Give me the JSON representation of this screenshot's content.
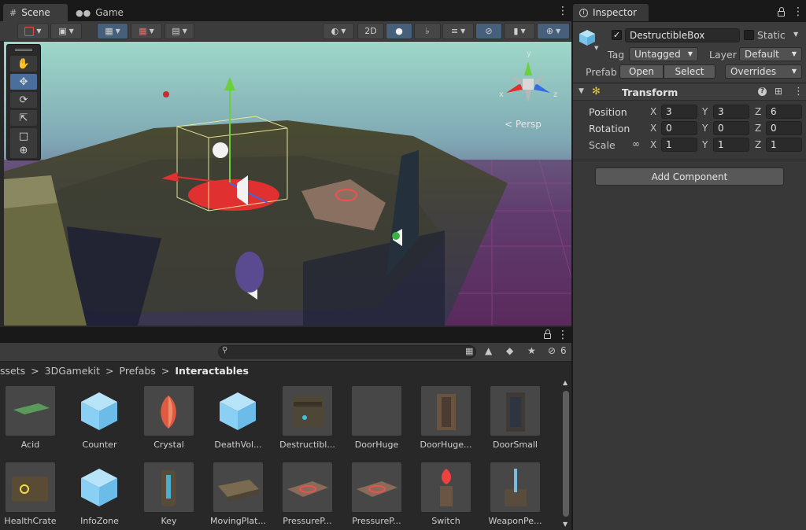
{
  "scene_tabs": [
    {
      "label": "Scene",
      "icon": "grid-icon"
    },
    {
      "label": "Game",
      "icon": "gamepad-icon"
    }
  ],
  "scene_toolbar": {
    "mode_2d": "2D"
  },
  "viewport": {
    "projection_label": "Persp",
    "gizmo_axes": {
      "x": "x",
      "y": "y",
      "z": "z"
    }
  },
  "project": {
    "filter_count": "6",
    "breadcrumb": [
      "ssets",
      "3DGamekit",
      "Prefabs",
      "Interactables"
    ],
    "assets": [
      {
        "label": "Acid",
        "thumb": "flat-green-plate"
      },
      {
        "label": "Counter",
        "thumb": "blue-cube"
      },
      {
        "label": "Crystal",
        "thumb": "red-crystal"
      },
      {
        "label": "DeathVol...",
        "thumb": "blue-cube"
      },
      {
        "label": "Destructibl...",
        "thumb": "crate"
      },
      {
        "label": "DoorHuge",
        "thumb": "empty"
      },
      {
        "label": "DoorHuge...",
        "thumb": "stone-door"
      },
      {
        "label": "DoorSmall",
        "thumb": "small-door"
      },
      {
        "label": "HealthCrate",
        "thumb": "health-crate"
      },
      {
        "label": "InfoZone",
        "thumb": "blue-cube"
      },
      {
        "label": "Key",
        "thumb": "key-pillar"
      },
      {
        "label": "MovingPlat...",
        "thumb": "moving-platform"
      },
      {
        "label": "PressureP...",
        "thumb": "pressure-pad"
      },
      {
        "label": "PressureP...",
        "thumb": "pressure-pad"
      },
      {
        "label": "Switch",
        "thumb": "switch"
      },
      {
        "label": "WeaponPe...",
        "thumb": "weapon-pedestal"
      }
    ]
  },
  "inspector": {
    "tab_label": "Inspector",
    "object_name": "DestructibleBox",
    "active": true,
    "static_label": "Static",
    "static": false,
    "tag_label": "Tag",
    "tag_value": "Untagged",
    "layer_label": "Layer",
    "layer_value": "Default",
    "prefab_label": "Prefab",
    "open_label": "Open",
    "select_label": "Select",
    "overrides_label": "Overrides",
    "transform": {
      "title": "Transform",
      "position_label": "Position",
      "rotation_label": "Rotation",
      "scale_label": "Scale",
      "position": {
        "x": "3",
        "y": "3",
        "z": "6"
      },
      "rotation": {
        "x": "0",
        "y": "0",
        "z": "0"
      },
      "scale": {
        "x": "1",
        "y": "1",
        "z": "1"
      },
      "axis_x": "X",
      "axis_y": "Y",
      "axis_z": "Z"
    },
    "add_component_label": "Add Component"
  },
  "colors": {
    "accent_blue": "#46607c",
    "cube_blue": "#8ad0f5",
    "sky_top": "#9ed8c8",
    "grid_magenta": "#8a3a7a"
  }
}
